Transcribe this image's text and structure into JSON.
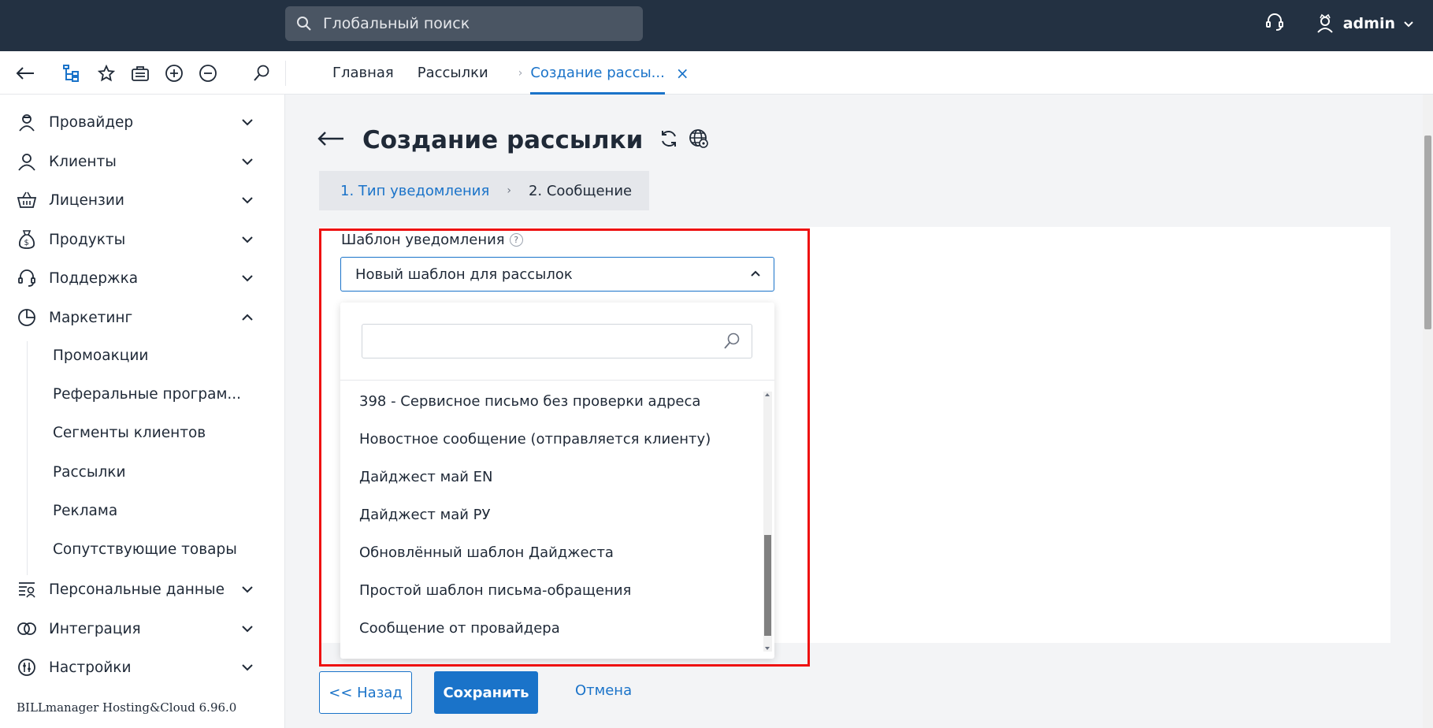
{
  "topbar": {
    "search_placeholder": "Глобальный поиск",
    "user_name": "admin"
  },
  "breadcrumbs": {
    "home": "Главная",
    "mailings": "Рассылки",
    "current": "Создание рассы...",
    "close": "×"
  },
  "sidebar": {
    "items": [
      {
        "label": "Провайдер",
        "icon": "provider-icon"
      },
      {
        "label": "Клиенты",
        "icon": "clients-icon"
      },
      {
        "label": "Лицензии",
        "icon": "basket-icon"
      },
      {
        "label": "Продукты",
        "icon": "money-bag-icon"
      },
      {
        "label": "Поддержка",
        "icon": "headset-icon"
      },
      {
        "label": "Маркетинг",
        "icon": "pie-chart-icon"
      },
      {
        "label": "Персональные данные",
        "icon": "personal-data-icon"
      },
      {
        "label": "Интеграция",
        "icon": "integration-icon"
      },
      {
        "label": "Настройки",
        "icon": "settings-icon"
      }
    ],
    "marketing_sub": [
      "Промоакции",
      "Реферальные програм...",
      "Сегменты клиентов",
      "Рассылки",
      "Реклама",
      "Сопутствующие товары"
    ],
    "version": "BILLmanager Hosting&Cloud 6.96.0"
  },
  "main": {
    "title": "Создание рассылки",
    "steps": {
      "step1": "1. Тип уведомления",
      "step2": "2. Сообщение"
    },
    "field_label": "Шаблон уведомления",
    "help": "?",
    "selected_template": "Новый шаблон для рассылок",
    "dropdown_search_value": "",
    "dropdown_options": [
      "398 - Сервисное письмо без проверки адреса",
      "Новостное сообщение (отправляется клиенту)",
      "Дайджест май EN",
      "Дайджест май РУ",
      "Обновлённый шаблон Дайджеста",
      "Простой шаблон письма-обращения",
      "Сообщение от провайдера"
    ],
    "buttons": {
      "back": "<< Назад",
      "save": "Сохранить",
      "cancel": "Отмена"
    }
  },
  "colors": {
    "topbar": "#233142",
    "accent": "#1a73c9",
    "highlight": "#ee1111"
  }
}
